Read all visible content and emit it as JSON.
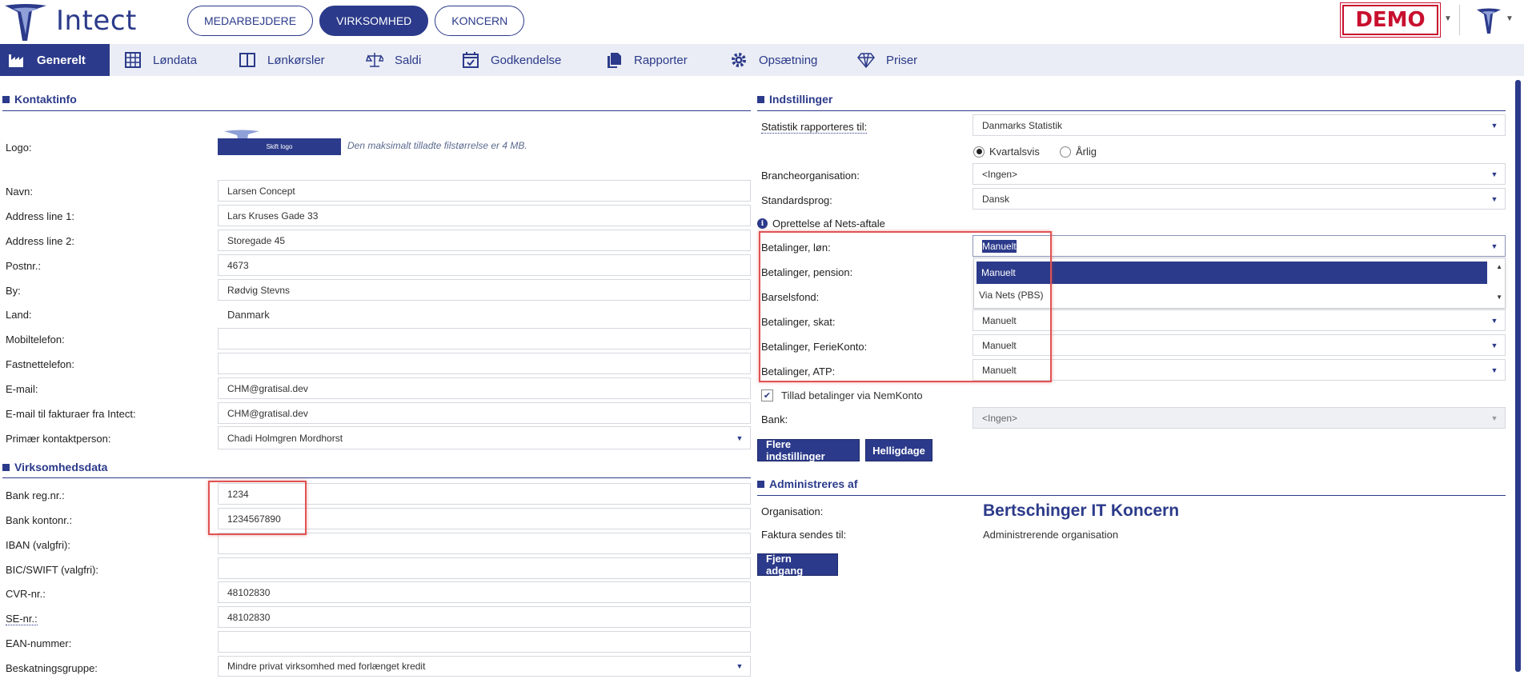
{
  "app": {
    "brand": "Intect",
    "demo_badge": "DEMO"
  },
  "topnav": [
    "MEDARBEJDERE",
    "VIRKSOMHED",
    "KONCERN"
  ],
  "menu": [
    "Generelt",
    "Løndata",
    "Lønkørsler",
    "Saldi",
    "Godkendelse",
    "Rapporter",
    "Opsætning",
    "Priser"
  ],
  "kontakt": {
    "title": "Kontaktinfo",
    "logo_label": "Logo:",
    "logo_button": "Skift logo",
    "logo_note": "Den maksimalt tilladte filstørrelse er 4 MB.",
    "rows": [
      {
        "label": "Navn:",
        "value": " Larsen Concept"
      },
      {
        "label": "Address line 1:",
        "value": "Lars Kruses Gade 33"
      },
      {
        "label": "Address line 2:",
        "value": "Storegade 45"
      },
      {
        "label": "Postnr.:",
        "value": "4673"
      },
      {
        "label": "By:",
        "value": "Rødvig Stevns"
      }
    ],
    "land_label": "Land:",
    "land_value": "Danmark",
    "rows2": [
      {
        "label": "Mobiltelefon:",
        "value": ""
      },
      {
        "label": "Fastnettelefon:",
        "value": ""
      },
      {
        "label": "E-mail:",
        "value": "CHM@gratisal.dev"
      },
      {
        "label": "E-mail til fakturaer fra Intect:",
        "value": "CHM@gratisal.dev"
      }
    ],
    "primary_label": "Primær kontaktperson:",
    "primary_value": "Chadi Holmgren Mordhorst"
  },
  "virksomhed": {
    "title": "Virksomhedsdata",
    "rows": [
      {
        "label": "Bank reg.nr.:",
        "value": "1234"
      },
      {
        "label": "Bank kontonr.:",
        "value": "1234567890"
      },
      {
        "label": "IBAN (valgfri):",
        "value": ""
      },
      {
        "label": "BIC/SWIFT (valgfri):",
        "value": ""
      },
      {
        "label": "CVR-nr.:",
        "value": "48102830"
      },
      {
        "label": "SE-nr.:",
        "value": "48102830"
      },
      {
        "label": "EAN-nummer:",
        "value": ""
      }
    ],
    "beskat_label": "Beskatningsgruppe:",
    "beskat_value": "Mindre privat virksomhed med forlænget kredit"
  },
  "indstillinger": {
    "title": "Indstillinger",
    "statistik_label": "Statistik rapporteres til:",
    "statistik_value": "Danmarks Statistik",
    "radio_kvartal": "Kvartalsvis",
    "radio_aarlig": "Årlig",
    "branche_label": "Brancheorganisation:",
    "branche_value": "<Ingen>",
    "sprog_label": "Standardsprog:",
    "sprog_value": "Dansk",
    "nets_info": "Oprettelse af Nets-aftale",
    "betal_lon_label": "Betalinger, løn:",
    "betal_lon_value": "Manuelt",
    "betal_pension_label": "Betalinger, pension:",
    "barsel_label": "Barselsfond:",
    "betal_skat_label": "Betalinger, skat:",
    "betal_skat_value": "Manuelt",
    "betal_ferie_label": "Betalinger, FerieKonto:",
    "betal_ferie_value": "Manuelt",
    "betal_atp_label": "Betalinger, ATP:",
    "betal_atp_value": "Manuelt",
    "dropdown_options": [
      "Manuelt",
      "Via Nets (PBS)"
    ],
    "nemkonto_label": "Tillad betalinger via NemKonto",
    "bank_label": "Bank:",
    "bank_value": "<Ingen>",
    "btn_flere": "Flere indstillinger",
    "btn_helligdage": "Helligdage"
  },
  "administreres": {
    "title": "Administreres af",
    "org_label": "Organisation:",
    "org_value": "Bertschinger IT Koncern",
    "faktura_label": "Faktura sendes til:",
    "faktura_value": "Administrerende organisation",
    "btn_fjern": "Fjern adgang"
  }
}
